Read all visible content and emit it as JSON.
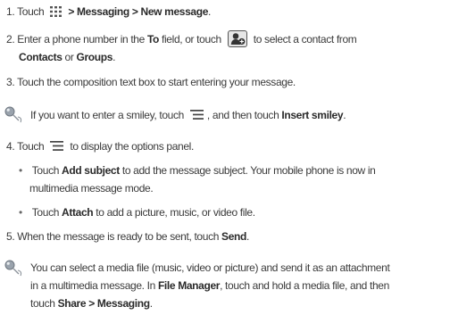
{
  "steps": [
    {
      "number": "1.",
      "parts": [
        "Touch",
        ">",
        "Messaging",
        ">",
        "New message",
        "."
      ]
    },
    {
      "number": "2.",
      "line1": [
        "Enter a phone number in the",
        "To",
        "field, or touch",
        "to select a contact from"
      ],
      "line2": [
        "Contacts",
        "or",
        "Groups",
        "."
      ]
    },
    {
      "number": "3.",
      "text": "Touch the composition text box to start entering your message."
    },
    {
      "number": "4.",
      "parts": [
        "Touch",
        "to display the options panel."
      ],
      "bullets": [
        {
          "line1": [
            "Touch",
            "Add subject",
            "to add the message subject. Your mobile phone is now in"
          ],
          "line2": "multimedia message mode."
        },
        {
          "line1": [
            "Touch",
            "Attach",
            "to add a picture, music, or video file."
          ]
        }
      ]
    },
    {
      "number": "5.",
      "parts": [
        "When the message is ready to be sent, touch",
        "Send",
        "."
      ]
    }
  ],
  "tips": [
    {
      "parts": [
        "If you want to enter a smiley, touch",
        ", and then touch",
        "Insert smiley",
        "."
      ]
    },
    {
      "line1": "You can select a media file (music, video or picture) and send it as an attachment",
      "line2": [
        "in a multimedia message. In",
        "File Manager",
        ", touch and hold a media file, and then"
      ],
      "line3": [
        "touch",
        "Share",
        ">",
        "Messaging",
        "."
      ]
    }
  ],
  "icons": {
    "apps": "apps-grid-icon",
    "contact": "contact-picker-icon",
    "menu": "menu-icon",
    "tip": "tip-icon"
  }
}
